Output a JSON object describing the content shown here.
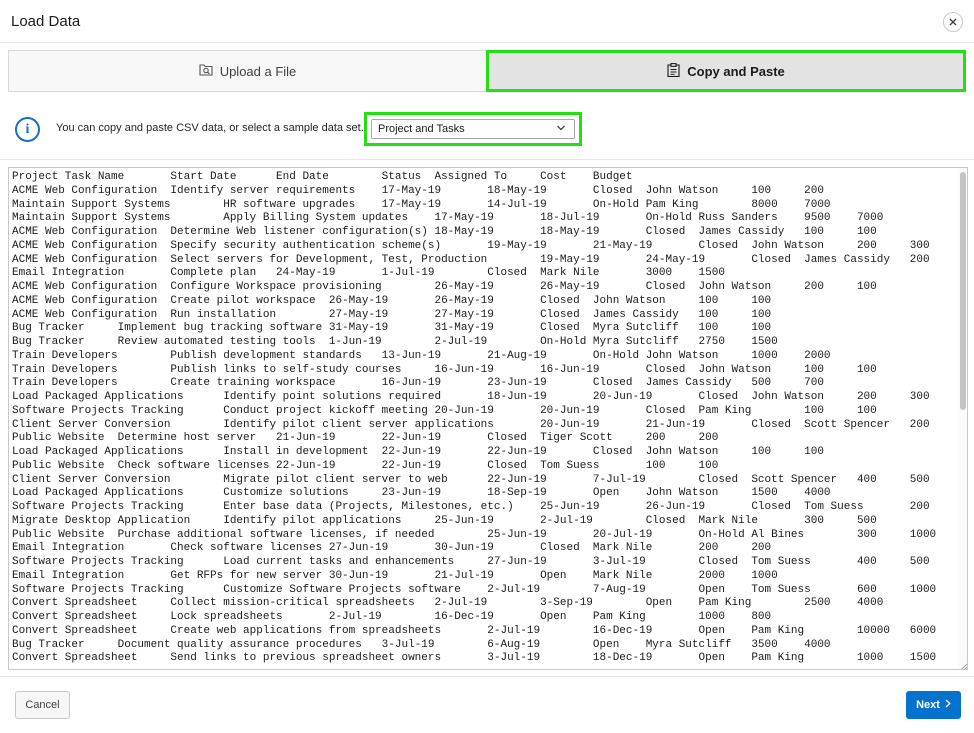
{
  "dialog": {
    "title": "Load Data",
    "close_icon": "close-icon"
  },
  "tabs": [
    {
      "label": "Upload a File",
      "icon": "upload-file-icon",
      "selected": false
    },
    {
      "label": "Copy and Paste",
      "icon": "clipboard-icon",
      "selected": true
    }
  ],
  "info": {
    "icon": "info-icon",
    "text": "You can copy and paste CSV data, or select a sample data set."
  },
  "sample_select": {
    "value": "Project and Tasks",
    "icon": "chevron-down-icon"
  },
  "csv_lines": [
    "Project Task Name       Start Date      End Date        Status  Assigned To     Cost    Budget",
    "ACME Web Configuration  Identify server requirements    17-May-19       18-May-19       Closed  John Watson     100     200",
    "Maintain Support Systems        HR software upgrades    17-May-19       14-Jul-19       On-Hold Pam King        8000    7000",
    "Maintain Support Systems        Apply Billing System updates    17-May-19       18-Jul-19       On-Hold Russ Sanders    9500    7000",
    "ACME Web Configuration  Determine Web listener configuration(s) 18-May-19       18-May-19       Closed  James Cassidy   100     100",
    "ACME Web Configuration  Specify security authentication scheme(s)       19-May-19       21-May-19       Closed  John Watson     200     300",
    "ACME Web Configuration  Select servers for Development, Test, Production        19-May-19       24-May-19       Closed  James Cassidy   200     600",
    "Email Integration       Complete plan   24-May-19       1-Jul-19        Closed  Mark Nile       3000    1500",
    "ACME Web Configuration  Configure Workspace provisioning        26-May-19       26-May-19       Closed  John Watson     200     100",
    "ACME Web Configuration  Create pilot workspace  26-May-19       26-May-19       Closed  John Watson     100     100",
    "ACME Web Configuration  Run installation        27-May-19       27-May-19       Closed  James Cassidy   100     100",
    "Bug Tracker     Implement bug tracking software 31-May-19       31-May-19       Closed  Myra Sutcliff   100     100",
    "Bug Tracker     Review automated testing tools  1-Jun-19        2-Jul-19        On-Hold Myra Sutcliff   2750    1500",
    "Train Developers        Publish development standards   13-Jun-19       21-Aug-19       On-Hold John Watson     1000    2000",
    "Train Developers        Publish links to self-study courses     16-Jun-19       16-Jun-19       Closed  John Watson     100     100",
    "Train Developers        Create training workspace       16-Jun-19       23-Jun-19       Closed  James Cassidy   500     700",
    "Load Packaged Applications      Identify point solutions required       18-Jun-19       20-Jun-19       Closed  John Watson     200     300",
    "Software Projects Tracking      Conduct project kickoff meeting 20-Jun-19       20-Jun-19       Closed  Pam King        100     100",
    "Client Server Conversion        Identify pilot client server applications       20-Jun-19       21-Jun-19       Closed  Scott Spencer   200     200",
    "Public Website  Determine host server   21-Jun-19       22-Jun-19       Closed  Tiger Scott     200     200",
    "Load Packaged Applications      Install in development  22-Jun-19       22-Jun-19       Closed  John Watson     100     100",
    "Public Website  Check software licenses 22-Jun-19       22-Jun-19       Closed  Tom Suess       100     100",
    "Client Server Conversion        Migrate pilot client server to web      22-Jun-19       7-Jul-19        Closed  Scott Spencer   400     500",
    "Load Packaged Applications      Customize solutions     23-Jun-19       18-Sep-19       Open    John Watson     1500    4000",
    "Software Projects Tracking      Enter base data (Projects, Milestones, etc.)    25-Jun-19       26-Jun-19       Closed  Tom Suess       200     200",
    "Migrate Desktop Application     Identify pilot applications     25-Jun-19       2-Jul-19        Closed  Mark Nile       300     500",
    "Public Website  Purchase additional software licenses, if needed        25-Jun-19       20-Jul-19       On-Hold Al Bines        300     1000",
    "Email Integration       Check software licenses 27-Jun-19       30-Jun-19       Closed  Mark Nile       200     200",
    "Software Projects Tracking      Load current tasks and enhancements     27-Jun-19       3-Jul-19        Closed  Tom Suess       400     500",
    "Email Integration       Get RFPs for new server 30-Jun-19       21-Jul-19       Open    Mark Nile       2000    1000",
    "Software Projects Tracking      Customize Software Projects software    2-Jul-19        7-Aug-19        Open    Tom Suess       600     1000",
    "Convert Spreadsheet     Collect mission-critical spreadsheets   2-Jul-19        3-Sep-19        Open    Pam King        2500    4000",
    "Convert Spreadsheet     Lock spreadsheets       2-Jul-19        16-Dec-19       Open    Pam King        1000    800",
    "Convert Spreadsheet     Create web applications from spreadsheets       2-Jul-19        16-Dec-19       Open    Pam King        10000   6000",
    "Bug Tracker     Document quality assurance procedures   3-Jul-19        6-Aug-19        Open    Myra Sutcliff   3500    4000",
    "Convert Spreadsheet     Send links to previous spreadsheet owners       3-Jul-19        18-Dec-19       Open    Pam King        1000    1500"
  ],
  "footer": {
    "cancel_label": "Cancel",
    "next_label": "Next",
    "next_icon": "chevron-right-icon"
  }
}
